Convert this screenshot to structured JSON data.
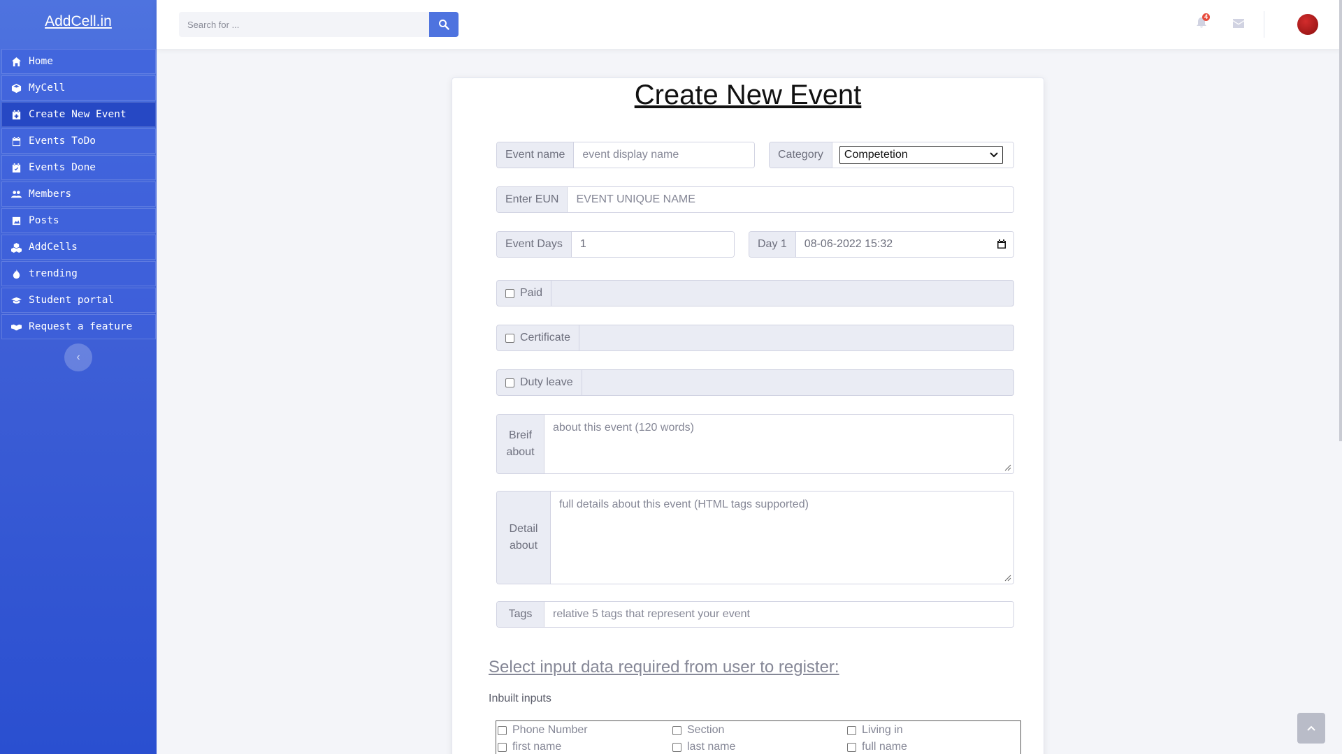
{
  "brand": {
    "name": "AddCell.in"
  },
  "sidebar": {
    "items": [
      {
        "label": "Home",
        "icon": "home-icon"
      },
      {
        "label": "MyCell",
        "icon": "cube-icon"
      },
      {
        "label": "Create New Event",
        "icon": "calendar-plus-icon",
        "active": true
      },
      {
        "label": "Events ToDo",
        "icon": "calendar-icon"
      },
      {
        "label": "Events Done",
        "icon": "calendar-check-icon"
      },
      {
        "label": "Members",
        "icon": "users-icon"
      },
      {
        "label": "Posts",
        "icon": "image-icon"
      },
      {
        "label": "AddCells",
        "icon": "cubes-icon"
      },
      {
        "label": "trending",
        "icon": "fire-icon"
      },
      {
        "label": "Student portal",
        "icon": "graduation-cap-icon"
      },
      {
        "label": "Request a feature",
        "icon": "handshake-icon"
      }
    ],
    "toggle_icon": "chevron-left-icon"
  },
  "topbar": {
    "search_placeholder": "Search for ...",
    "notification_count": "4"
  },
  "form": {
    "title": "Create New Event",
    "event_name": {
      "label": "Event name",
      "placeholder": "event display name"
    },
    "category": {
      "label": "Category",
      "value": "Competetion"
    },
    "eun": {
      "label": "Enter EUN",
      "placeholder": "EVENT UNIQUE NAME"
    },
    "event_days": {
      "label": "Event Days",
      "value": "1"
    },
    "day1": {
      "label": "Day 1",
      "value": "08-06-2022 15:32"
    },
    "paid": {
      "label": "Paid"
    },
    "certificate": {
      "label": "Certificate"
    },
    "duty_leave": {
      "label": "Duty leave"
    },
    "brief": {
      "label_line1": "Breif",
      "label_line2": "about",
      "placeholder": "about this event (120 words)"
    },
    "detail": {
      "label_line1": "Detail",
      "label_line2": "about",
      "placeholder": "full details about this event (HTML tags supported)"
    },
    "tags": {
      "label": "Tags",
      "placeholder": "relative 5 tags that represent your event"
    },
    "register_title": "Select input data required from user to register:",
    "inbuilt_label": "Inbuilt inputs",
    "inbuilt_options": [
      "Phone Number",
      "Section",
      "Living in",
      "first name",
      "last name",
      "full name"
    ]
  },
  "colors": {
    "primary": "#4e73df",
    "sidebar_active": "#2648c4",
    "badge": "#e74a3b"
  }
}
